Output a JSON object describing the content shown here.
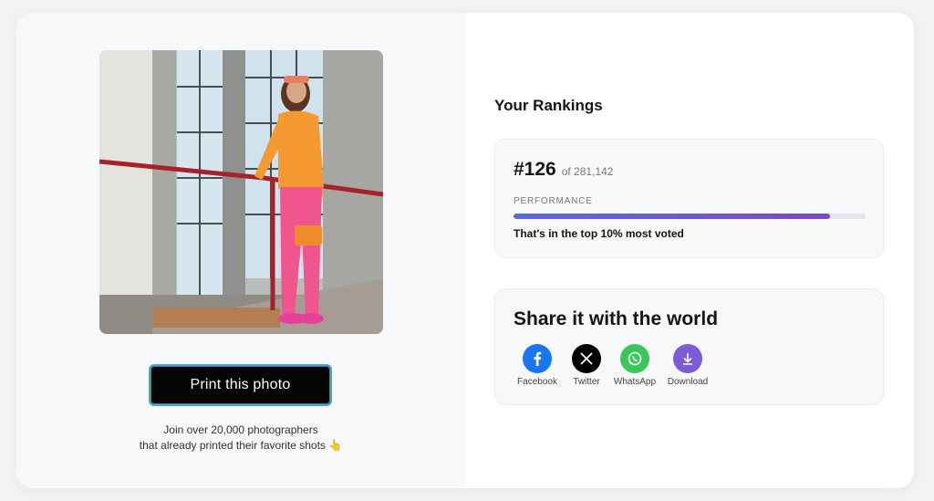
{
  "left": {
    "print_button_label": "Print this photo",
    "join_line1": "Join over 20,000 photographers",
    "join_line2": "that already printed their favorite shots 👆"
  },
  "rankings": {
    "heading": "Your Rankings",
    "rank": "#126",
    "of_total": "of 281,142",
    "performance_label": "PERFORMANCE",
    "performance_fraction": 0.9,
    "top_text": "That's in the top 10% most voted"
  },
  "share": {
    "title": "Share it with the world",
    "items": [
      {
        "label": "Facebook",
        "icon": "facebook-icon",
        "color": "#1877f2"
      },
      {
        "label": "Twitter",
        "icon": "x-icon",
        "color": "#000000"
      },
      {
        "label": "WhatsApp",
        "icon": "whatsapp-icon",
        "color": "#39c65a"
      },
      {
        "label": "Download",
        "icon": "download-icon",
        "color": "#7b5cd6"
      }
    ]
  }
}
